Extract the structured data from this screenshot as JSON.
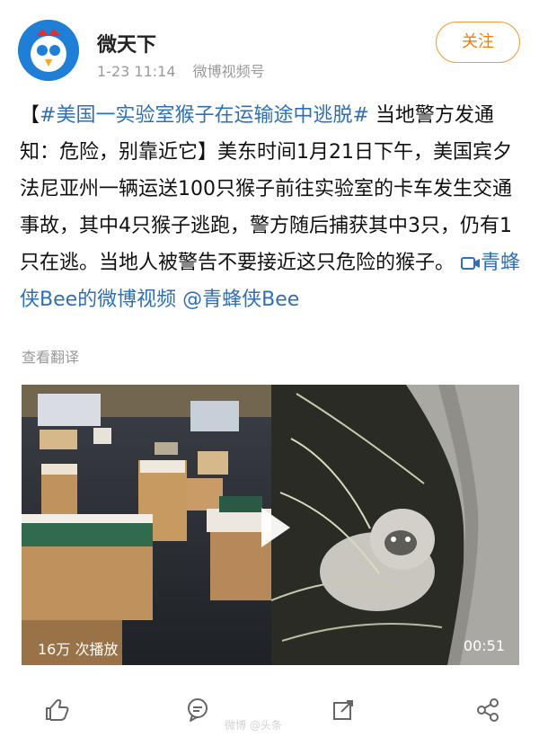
{
  "header": {
    "username": "微天下",
    "time": "1-23 11:14",
    "source": "微博视频号",
    "follow_label": "关注"
  },
  "post": {
    "prefix": "【",
    "hashtag": "#美国一实验室猴子在运输途中逃脱#",
    "body": " 当地警方发通知：危险，别靠近它】美东时间1月21日下午，美国宾夕法尼亚州一辆运送100只猴子前往实验室的卡车发生交通事故，其中4只猴子逃跑，警方随后捕获其中3只，仍有1只在逃。当地人被警告不要接近这只危险的猴子。",
    "video_link": "青蜂侠Bee的微博视频",
    "mention": "@青蜂侠Bee",
    "translate": "查看翻译"
  },
  "video": {
    "play_count": "16万 次播放",
    "duration": "00:51"
  },
  "actions": {
    "icons": [
      "thumb-up-icon",
      "comment-icon",
      "share-icon",
      "forward-icon"
    ]
  },
  "watermark": "微博 @头条"
}
